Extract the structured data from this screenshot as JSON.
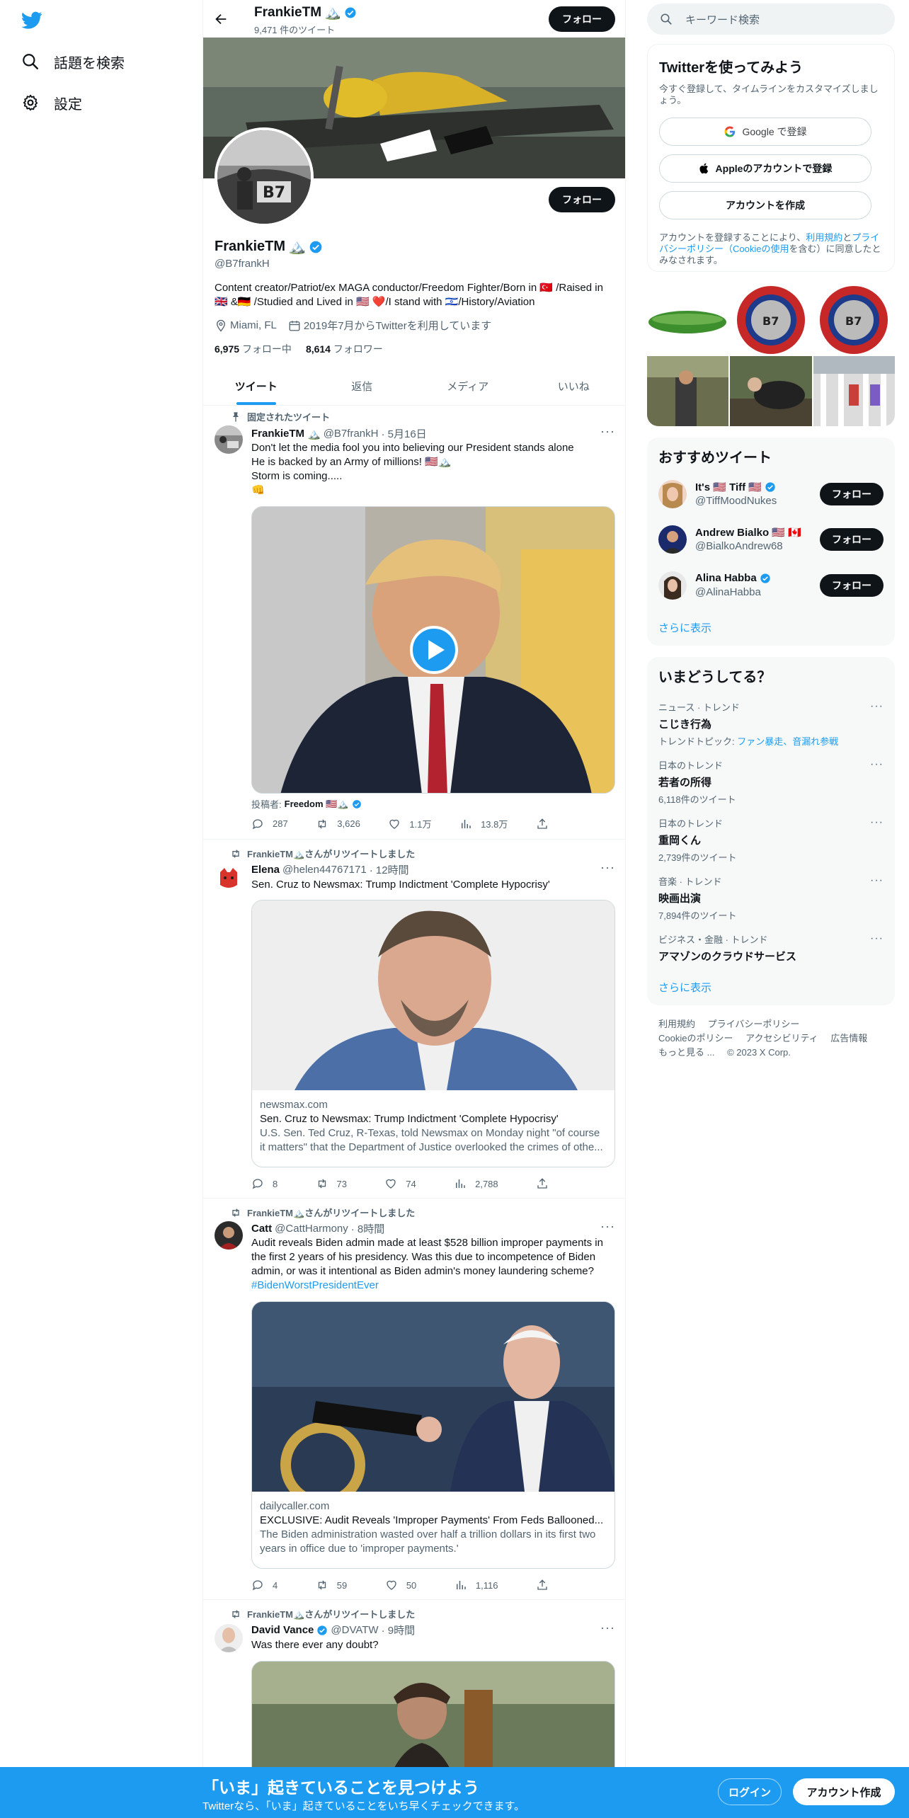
{
  "colors": {
    "accent": "#1d9bf0",
    "text": "#0f1419",
    "muted": "#536471",
    "border": "#eff3f4"
  },
  "nav": {
    "explore_label": "話題を検索",
    "settings_label": "設定"
  },
  "profile": {
    "top_name": "FrankieTM",
    "tweet_count": "9,471 件のツイート",
    "follow_label": "フォロー",
    "name": "FrankieTM",
    "handle": "@B7frankH",
    "bio_line1": "Content creator/Patriot/ex MAGA conductor/Freedom Fighter/Born in 🇹🇷 /Raised in",
    "bio_line2": "🇬🇧 &🇩🇪 /Studied and Lived in 🇺🇸 ❤️/I stand with 🇮🇱/History/Aviation",
    "location": "Miami, FL",
    "joined": "2019年7月からTwitterを利用しています",
    "following_count": "6,975",
    "following_label": "フォロー中",
    "followers_count": "8,614",
    "followers_label": "フォロワー"
  },
  "tabs": [
    "ツイート",
    "返信",
    "メディア",
    "いいね"
  ],
  "tweets": [
    {
      "context": "固定されたツイート",
      "name": "FrankieTM",
      "handle": "@B7frankH",
      "time": "· 5月16日",
      "text": [
        "Don't let the media fool you into believing our President stands alone",
        "He is backed by an Army of millions! 🇺🇸🏔️",
        "Storm is coming.....",
        "👊"
      ],
      "posted_by": "投稿者: ",
      "posted_by_name": "Freedom 🇺🇸🏔️",
      "replies": "287",
      "retweets": "3,626",
      "likes": "1.1万",
      "views": "13.8万"
    },
    {
      "context": "FrankieTM🏔️さんがリツイートしました",
      "name": "Elena",
      "handle": "@helen44767171",
      "time": "· 12時間",
      "text": [
        "Sen. Cruz to Newsmax: Trump Indictment 'Complete Hypocrisy'"
      ],
      "card_domain": "newsmax.com",
      "card_title": "Sen. Cruz to Newsmax: Trump Indictment 'Complete Hypocrisy'",
      "card_desc1": "U.S. Sen. Ted Cruz, R-Texas, told Newsmax on Monday night \"of course",
      "card_desc2": "it matters\" that the Department of Justice overlooked the crimes of othe...",
      "replies": "8",
      "retweets": "73",
      "likes": "74",
      "views": "2,788"
    },
    {
      "context": "FrankieTM🏔️さんがリツイートしました",
      "name": "Catt",
      "handle": "@CattHarmony",
      "time": "· 8時間",
      "text": [
        "Audit reveals Biden admin made at least $528 billion improper payments in",
        "the first 2 years of his presidency. Was this due to incompetence of Biden",
        "admin, or was it intentional as Biden admin's money laundering scheme?"
      ],
      "hashtag": "#BidenWorstPresidentEver",
      "card_domain": "dailycaller.com",
      "card_title": "EXCLUSIVE: Audit Reveals 'Improper Payments' From Feds Ballooned...",
      "card_desc1": "The Biden administration wasted over half a trillion dollars in its first two",
      "card_desc2": "years in office due to 'improper payments.'",
      "replies": "4",
      "retweets": "59",
      "likes": "50",
      "views": "1,116"
    },
    {
      "context": "FrankieTM🏔️さんがリツイートしました",
      "name": "David Vance",
      "handle": "@DVATW",
      "time": "· 9時間",
      "text": [
        "Was there ever any doubt?"
      ]
    }
  ],
  "right": {
    "search_placeholder": "キーワード検索",
    "signup_title": "Twitterを使ってみよう",
    "signup_sub": "今すぐ登録して、タイムラインをカスタマイズしましょう。",
    "google_btn": "Google で登録",
    "apple_btn": "Appleのアカウントで登録",
    "create_btn": "アカウントを作成",
    "legal_pre": "アカウントを登録することにより、",
    "legal_terms": "利用規約",
    "legal_and": "と",
    "legal_privacy": "プライバシーポリシー（Cookieの使用",
    "legal_post": "を含む）に同意したとみなされます。",
    "rec_title": "おすすめツイート",
    "recs": [
      {
        "name": "It's 🇺🇸 Tiff 🇺🇸",
        "handle": "@TiffMoodNukes",
        "btn": "フォロー"
      },
      {
        "name": "Andrew Bialko 🇺🇸 🇨🇦",
        "handle": "@BialkoAndrew68",
        "btn": "フォロー"
      },
      {
        "name": "Alina Habba",
        "handle": "@AlinaHabba",
        "btn": "フォロー"
      }
    ],
    "show_more": "さらに表示",
    "trends_title": "いまどうしてる？",
    "trends": [
      {
        "cat": "ニュース · トレンド",
        "name": "こじき行為",
        "extra_pre": "トレンドトピック: ",
        "extra_link": "ファン暴走、音漏れ参戦"
      },
      {
        "cat": "日本のトレンド",
        "name": "若者の所得",
        "extra": "6,118件のツイート"
      },
      {
        "cat": "日本のトレンド",
        "name": "重岡くん",
        "extra": "2,739件のツイート"
      },
      {
        "cat": "音楽 · トレンド",
        "name": "映画出演",
        "extra": "7,894件のツイート"
      },
      {
        "cat": "ビジネス・金融 · トレンド",
        "name": "アマゾンのクラウドサービス",
        "extra": ""
      }
    ],
    "show_more2": "さらに表示",
    "footer": [
      "利用規約",
      "プライバシーポリシー",
      "Cookieのポリシー",
      "アクセシビリティ",
      "広告情報",
      "もっと見る ...",
      "© 2023 X Corp."
    ]
  },
  "bottom": {
    "title": "「いま」起きていることを見つけよう",
    "sub": "Twitterなら、「いま」起きていることをいち早くチェックできます。",
    "login": "ログイン",
    "signup": "アカウント作成"
  }
}
